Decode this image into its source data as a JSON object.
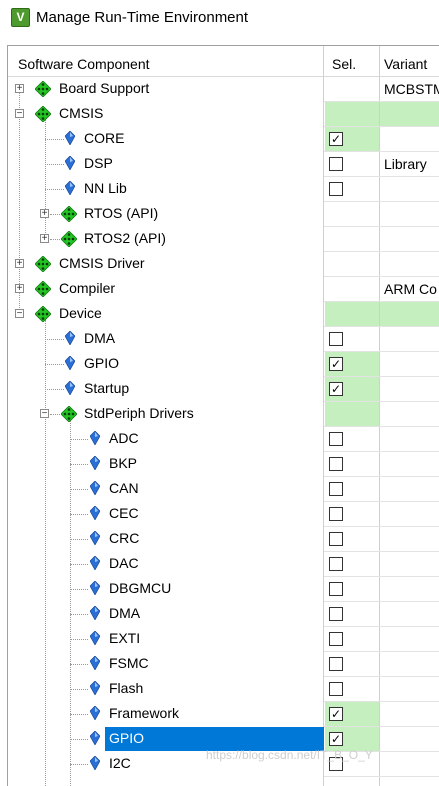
{
  "window": {
    "title": "Manage Run-Time Environment",
    "icon": "keil-rte-icon",
    "icon_glyph": "V"
  },
  "columns": {
    "component": "Software Component",
    "sel": "Sel.",
    "variant": "Variant"
  },
  "colors": {
    "selected_bg": "#0078d7",
    "sel_ok_green": "#c6efc0",
    "package_green": "#22c522"
  },
  "rows": [
    {
      "label": "Board Support",
      "level": 0,
      "type": "pack",
      "expander": "+",
      "checkbox": false,
      "checked": false,
      "sel_green": false,
      "var_green": false,
      "variant": "MCBSTM"
    },
    {
      "label": "CMSIS",
      "level": 0,
      "type": "pack",
      "expander": "−",
      "checkbox": false,
      "checked": false,
      "sel_green": true,
      "var_green": true,
      "variant": ""
    },
    {
      "label": "CORE",
      "level": 1,
      "type": "item",
      "expander": "",
      "checkbox": true,
      "checked": true,
      "sel_green": true,
      "var_green": false,
      "variant": ""
    },
    {
      "label": "DSP",
      "level": 1,
      "type": "item",
      "expander": "",
      "checkbox": true,
      "checked": false,
      "sel_green": false,
      "var_green": false,
      "variant": "Library"
    },
    {
      "label": "NN Lib",
      "level": 1,
      "type": "item",
      "expander": "",
      "checkbox": true,
      "checked": false,
      "sel_green": false,
      "var_green": false,
      "variant": ""
    },
    {
      "label": "RTOS (API)",
      "level": 1,
      "type": "pack",
      "expander": "+",
      "checkbox": false,
      "checked": false,
      "sel_green": false,
      "var_green": false,
      "variant": ""
    },
    {
      "label": "RTOS2 (API)",
      "level": 1,
      "type": "pack",
      "expander": "+",
      "checkbox": false,
      "checked": false,
      "sel_green": false,
      "var_green": false,
      "variant": ""
    },
    {
      "label": "CMSIS Driver",
      "level": 0,
      "type": "pack",
      "expander": "+",
      "checkbox": false,
      "checked": false,
      "sel_green": false,
      "var_green": false,
      "variant": ""
    },
    {
      "label": "Compiler",
      "level": 0,
      "type": "pack",
      "expander": "+",
      "checkbox": false,
      "checked": false,
      "sel_green": false,
      "var_green": false,
      "variant": "ARM Co"
    },
    {
      "label": "Device",
      "level": 0,
      "type": "pack",
      "expander": "−",
      "checkbox": false,
      "checked": false,
      "sel_green": true,
      "var_green": true,
      "variant": ""
    },
    {
      "label": "DMA",
      "level": 1,
      "type": "item",
      "expander": "",
      "checkbox": true,
      "checked": false,
      "sel_green": false,
      "var_green": false,
      "variant": ""
    },
    {
      "label": "GPIO",
      "level": 1,
      "type": "item",
      "expander": "",
      "checkbox": true,
      "checked": true,
      "sel_green": true,
      "var_green": false,
      "variant": ""
    },
    {
      "label": "Startup",
      "level": 1,
      "type": "item",
      "expander": "",
      "checkbox": true,
      "checked": true,
      "sel_green": true,
      "var_green": false,
      "variant": ""
    },
    {
      "label": "StdPeriph Drivers",
      "level": 1,
      "type": "pack",
      "expander": "−",
      "checkbox": false,
      "checked": false,
      "sel_green": true,
      "var_green": false,
      "variant": ""
    },
    {
      "label": "ADC",
      "level": 2,
      "type": "item",
      "expander": "",
      "checkbox": true,
      "checked": false,
      "sel_green": false,
      "var_green": false,
      "variant": ""
    },
    {
      "label": "BKP",
      "level": 2,
      "type": "item",
      "expander": "",
      "checkbox": true,
      "checked": false,
      "sel_green": false,
      "var_green": false,
      "variant": ""
    },
    {
      "label": "CAN",
      "level": 2,
      "type": "item",
      "expander": "",
      "checkbox": true,
      "checked": false,
      "sel_green": false,
      "var_green": false,
      "variant": ""
    },
    {
      "label": "CEC",
      "level": 2,
      "type": "item",
      "expander": "",
      "checkbox": true,
      "checked": false,
      "sel_green": false,
      "var_green": false,
      "variant": ""
    },
    {
      "label": "CRC",
      "level": 2,
      "type": "item",
      "expander": "",
      "checkbox": true,
      "checked": false,
      "sel_green": false,
      "var_green": false,
      "variant": ""
    },
    {
      "label": "DAC",
      "level": 2,
      "type": "item",
      "expander": "",
      "checkbox": true,
      "checked": false,
      "sel_green": false,
      "var_green": false,
      "variant": ""
    },
    {
      "label": "DBGMCU",
      "level": 2,
      "type": "item",
      "expander": "",
      "checkbox": true,
      "checked": false,
      "sel_green": false,
      "var_green": false,
      "variant": ""
    },
    {
      "label": "DMA",
      "level": 2,
      "type": "item",
      "expander": "",
      "checkbox": true,
      "checked": false,
      "sel_green": false,
      "var_green": false,
      "variant": ""
    },
    {
      "label": "EXTI",
      "level": 2,
      "type": "item",
      "expander": "",
      "checkbox": true,
      "checked": false,
      "sel_green": false,
      "var_green": false,
      "variant": ""
    },
    {
      "label": "FSMC",
      "level": 2,
      "type": "item",
      "expander": "",
      "checkbox": true,
      "checked": false,
      "sel_green": false,
      "var_green": false,
      "variant": ""
    },
    {
      "label": "Flash",
      "level": 2,
      "type": "item",
      "expander": "",
      "checkbox": true,
      "checked": false,
      "sel_green": false,
      "var_green": false,
      "variant": ""
    },
    {
      "label": "Framework",
      "level": 2,
      "type": "item",
      "expander": "",
      "checkbox": true,
      "checked": true,
      "sel_green": true,
      "var_green": false,
      "variant": ""
    },
    {
      "label": "GPIO",
      "level": 2,
      "type": "item",
      "expander": "",
      "checkbox": true,
      "checked": true,
      "sel_green": true,
      "var_green": false,
      "variant": "",
      "selected": true
    },
    {
      "label": "I2C",
      "level": 2,
      "type": "item",
      "expander": "",
      "checkbox": true,
      "checked": false,
      "sel_green": false,
      "var_green": false,
      "variant": ""
    }
  ],
  "watermark": "https://blog.csdn.net/IT_B_O_Y"
}
